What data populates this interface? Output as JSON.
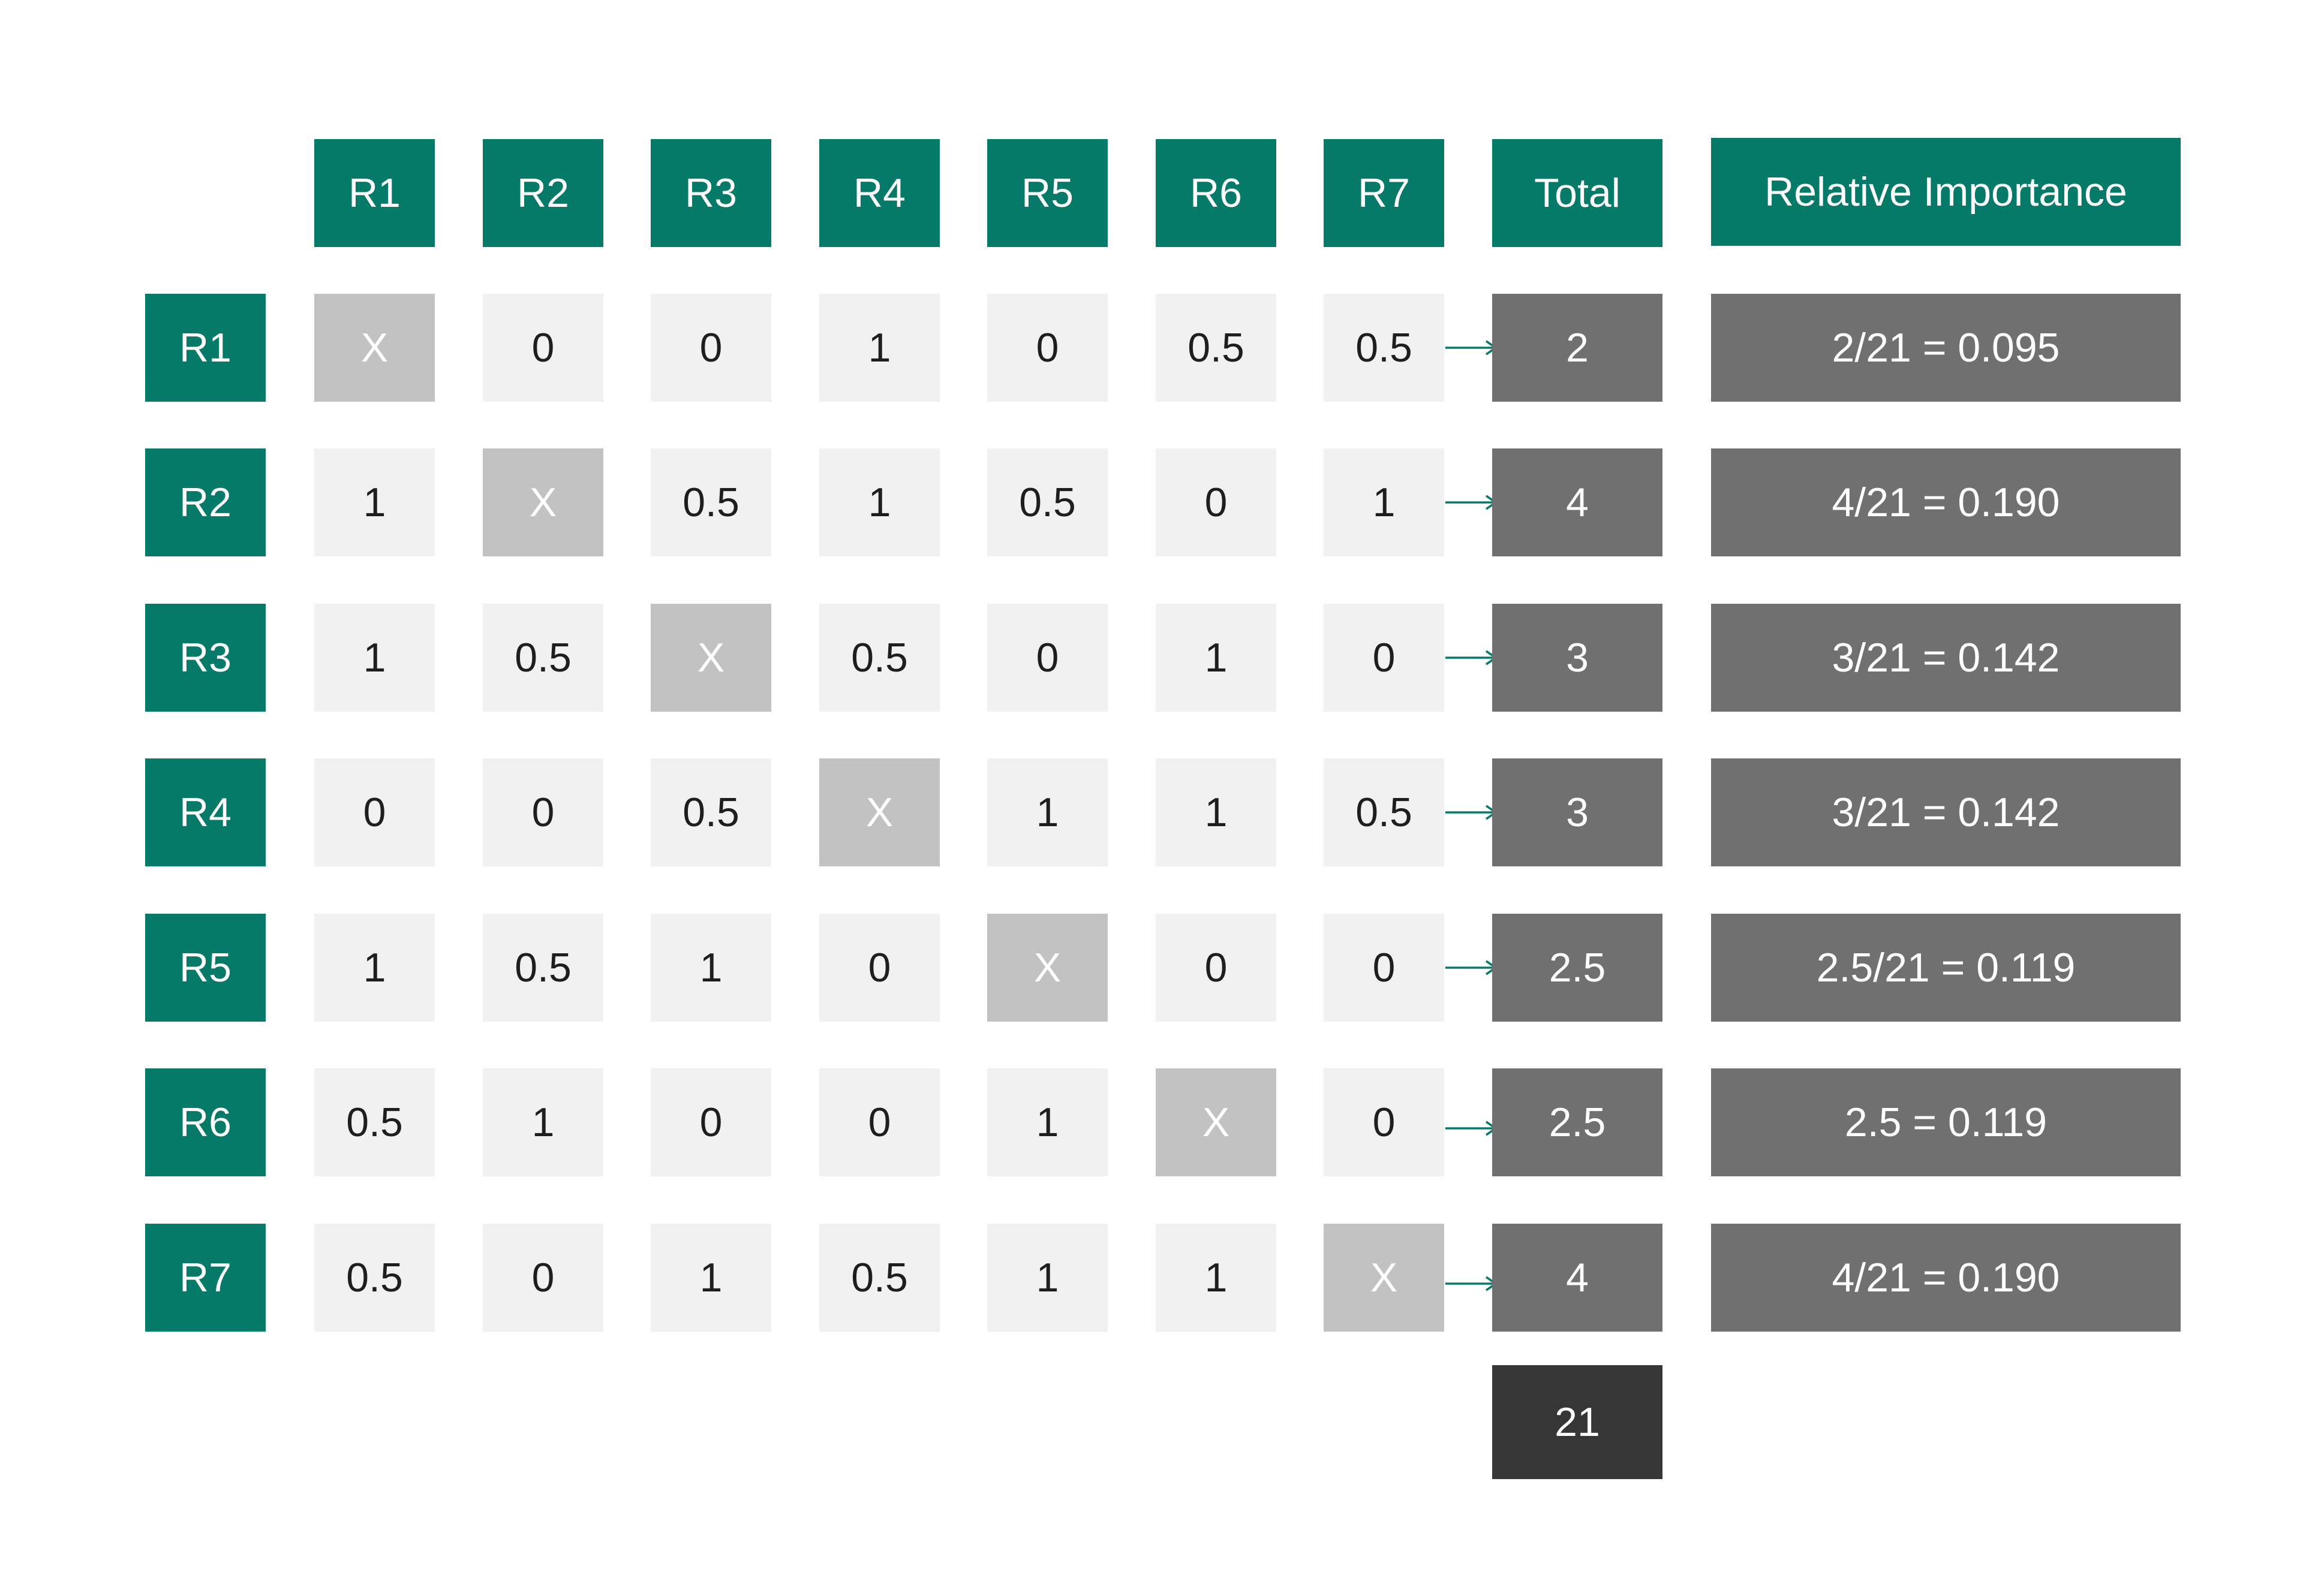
{
  "headers": {
    "columns": [
      "R1",
      "R2",
      "R3",
      "R4",
      "R5",
      "R6",
      "R7"
    ],
    "total": "Total",
    "relative": "Relative Importance"
  },
  "rows": [
    {
      "label": "R1",
      "cells": [
        "X",
        "0",
        "0",
        "1",
        "0",
        "0.5",
        "0.5"
      ],
      "total": "2",
      "relative": "2/21 = 0.095"
    },
    {
      "label": "R2",
      "cells": [
        "1",
        "X",
        "0.5",
        "1",
        "0.5",
        "0",
        "1"
      ],
      "total": "4",
      "relative": "4/21 = 0.190"
    },
    {
      "label": "R3",
      "cells": [
        "1",
        "0.5",
        "X",
        "0.5",
        "0",
        "1",
        "0"
      ],
      "total": "3",
      "relative": "3/21 = 0.142"
    },
    {
      "label": "R4",
      "cells": [
        "0",
        "0",
        "0.5",
        "X",
        "1",
        "1",
        "0.5"
      ],
      "total": "3",
      "relative": "3/21 = 0.142"
    },
    {
      "label": "R5",
      "cells": [
        "1",
        "0.5",
        "1",
        "0",
        "X",
        "0",
        "0"
      ],
      "total": "2.5",
      "relative": "2.5/21 = 0.119"
    },
    {
      "label": "R6",
      "cells": [
        "0.5",
        "1",
        "0",
        "0",
        "1",
        "X",
        "0"
      ],
      "total": "2.5",
      "relative": "2.5 = 0.119"
    },
    {
      "label": "R7",
      "cells": [
        "0.5",
        "0",
        "1",
        "0.5",
        "1",
        "1",
        "X"
      ],
      "total": "4",
      "relative": "4/21 = 0.190"
    }
  ],
  "grand_total": "21",
  "colors": {
    "header": "#057a68",
    "cell": "#f1f1f1",
    "diagonal": "#c2c2c2",
    "total": "#707070",
    "grand_total": "#363636",
    "arrow": "#057a68"
  }
}
